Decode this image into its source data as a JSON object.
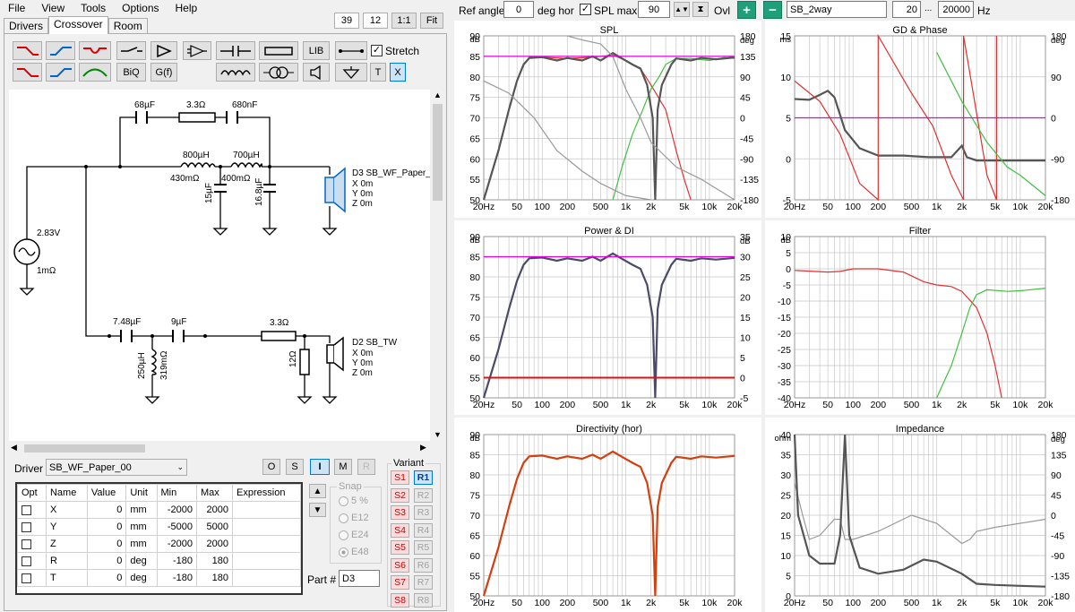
{
  "menu": [
    "File",
    "View",
    "Tools",
    "Options",
    "Help"
  ],
  "tabs": [
    "Drivers",
    "Crossover",
    "Room"
  ],
  "view": {
    "v1": "39",
    "v2": "12",
    "one_to_one": "1:1",
    "fit": "Fit"
  },
  "toolbar": {
    "biq": "BiQ",
    "gf": "G(f)",
    "lib": "LIB",
    "t": "T",
    "x": "X",
    "stretch": "Stretch",
    "stretch_checked": true
  },
  "schematic": {
    "c1": "68µF",
    "r1": "3.3Ω",
    "c2": "680nF",
    "l1": "800µH",
    "l1r": "430mΩ",
    "l2": "700µH",
    "l2r": "400mΩ",
    "c3": "15µF",
    "c4": "16.8µF",
    "src_v": "2.83V",
    "src_r": "1mΩ",
    "d3_name": "D3 SB_WF_Paper_",
    "d3_x": "X 0m",
    "d3_y": "Y 0m",
    "d3_z": "Z 0m",
    "c5": "7.48µF",
    "c6": "9µF",
    "r2": "3.3Ω",
    "l3": "250µH",
    "l3r": "319mΩ",
    "r3": "12Ω",
    "d2_name": "D2 SB_TW",
    "d2_x": "X 0m",
    "d2_y": "Y 0m",
    "d2_z": "Z 0m"
  },
  "driver": {
    "label": "Driver",
    "value": "SB_WF_Paper_00",
    "btns": [
      "O",
      "S",
      "I",
      "M",
      "R"
    ]
  },
  "params": {
    "headers": [
      "Opt",
      "Name",
      "Value",
      "Unit",
      "Min",
      "Max",
      "Expression"
    ],
    "rows": [
      {
        "name": "X",
        "value": "0",
        "unit": "mm",
        "min": "-2000",
        "max": "2000"
      },
      {
        "name": "Y",
        "value": "0",
        "unit": "mm",
        "min": "-5000",
        "max": "5000"
      },
      {
        "name": "Z",
        "value": "0",
        "unit": "mm",
        "min": "-2000",
        "max": "2000"
      },
      {
        "name": "R",
        "value": "0",
        "unit": "deg",
        "min": "-180",
        "max": "180"
      },
      {
        "name": "T",
        "value": "0",
        "unit": "deg",
        "min": "-180",
        "max": "180"
      }
    ]
  },
  "snap": {
    "label": "Snap",
    "options": [
      "5 %",
      "E12",
      "E24",
      "E48"
    ]
  },
  "part": {
    "label": "Part #",
    "value": "D3"
  },
  "variant": {
    "label": "Variant",
    "s": [
      "S1",
      "S2",
      "S3",
      "S4",
      "S5",
      "S6",
      "S7",
      "S8"
    ],
    "r": [
      "R1",
      "R2",
      "R3",
      "R4",
      "R5",
      "R6",
      "R7",
      "R8"
    ]
  },
  "top": {
    "ref_angle_label": "Ref angle",
    "ref_angle": "0",
    "deg_hor": "deg hor",
    "spl_max_label": "SPL max",
    "spl_max": "90",
    "ovl": "Ovl",
    "name": "SB_2way",
    "f_lo": "20",
    "dots": "...",
    "f_hi": "20000",
    "hz": "Hz"
  },
  "xticks": [
    "20Hz",
    "50",
    "100",
    "200",
    "500",
    "1k",
    "2k",
    "5k",
    "10k",
    "20k"
  ],
  "graphs": {
    "spl": {
      "title": "SPL",
      "unit_l": "dB",
      "unit_r": "deg",
      "yl": [
        "90",
        "85",
        "80",
        "75",
        "70",
        "65",
        "60",
        "55",
        "50"
      ],
      "yr": [
        "180",
        "135",
        "90",
        "45",
        "0",
        "-45",
        "-90",
        "-135",
        "-180"
      ]
    },
    "gd": {
      "title": "GD & Phase",
      "unit_l": "ms",
      "unit_r": "deg",
      "yl": [
        "15",
        "10",
        "5",
        "0",
        "-5"
      ],
      "yr": [
        "180",
        "90",
        "0",
        "-90",
        "-180"
      ]
    },
    "power": {
      "title": "Power & DI",
      "unit_l": "dB",
      "unit_r": "dB",
      "yl": [
        "90",
        "85",
        "80",
        "75",
        "70",
        "65",
        "60",
        "55",
        "50"
      ],
      "yr": [
        "35",
        "30",
        "25",
        "20",
        "15",
        "10",
        "5",
        "0",
        "-5"
      ]
    },
    "filter": {
      "title": "Filter",
      "unit_l": "dB",
      "yl": [
        "10",
        "5",
        "0",
        "-5",
        "-10",
        "-15",
        "-20",
        "-25",
        "-30",
        "-35",
        "-40"
      ]
    },
    "dir": {
      "title": "Directivity (hor)",
      "unit_l": "dB",
      "yl": [
        "90",
        "85",
        "80",
        "75",
        "70",
        "65",
        "60",
        "55",
        "50"
      ]
    },
    "imp": {
      "title": "Impedance",
      "unit_l": "ohm",
      "unit_r": "deg",
      "yl": [
        "40",
        "35",
        "30",
        "25",
        "20",
        "15",
        "10",
        "5",
        "0"
      ],
      "yr": [
        "180",
        "135",
        "90",
        "45",
        "0",
        "-45",
        "-90",
        "-135",
        "-180"
      ]
    }
  }
}
